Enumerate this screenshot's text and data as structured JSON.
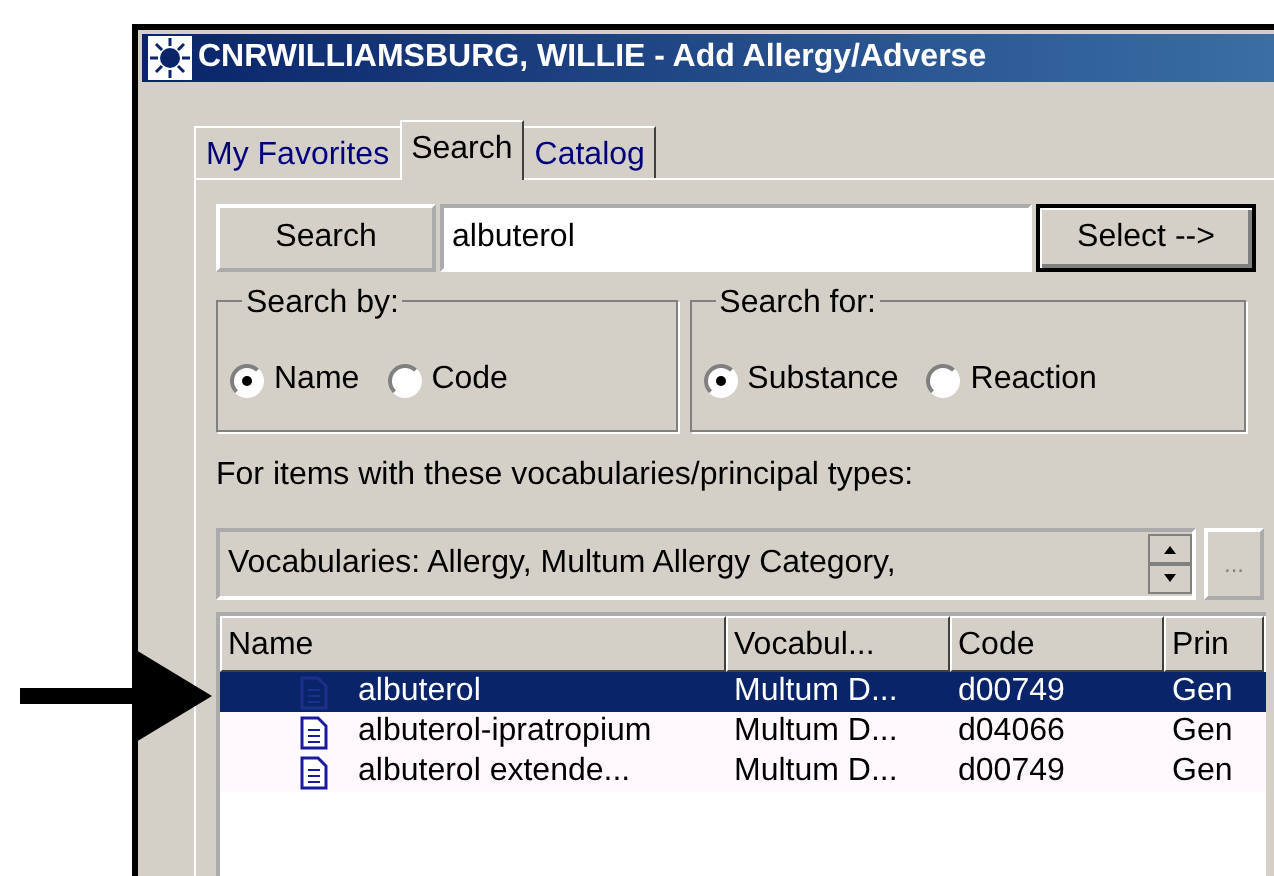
{
  "window": {
    "title": "CNRWILLIAMSBURG, WILLIE - Add Allergy/Adverse"
  },
  "tabs": [
    {
      "label": "My Favorites",
      "selected": false
    },
    {
      "label": "Search",
      "selected": true
    },
    {
      "label": "Catalog",
      "selected": false
    }
  ],
  "search": {
    "button": "Search",
    "value": "albuterol",
    "select_button": "Select -->"
  },
  "groups": [
    {
      "title": "Search by:",
      "options": [
        {
          "label": "Name",
          "checked": true
        },
        {
          "label": "Code",
          "checked": false
        }
      ]
    },
    {
      "title": "Search for:",
      "options": [
        {
          "label": "Substance",
          "checked": true
        },
        {
          "label": "Reaction",
          "checked": false
        }
      ]
    }
  ],
  "vocab_label": "For items with these vocabularies/principal types:",
  "vocab_field": {
    "value": "Vocabularies: Allergy, Multum Allergy Category,",
    "browse_button": "..."
  },
  "table": {
    "columns": [
      "Name",
      "Vocabul...",
      "Code",
      "Prin"
    ],
    "rows": [
      {
        "cells": [
          "albuterol",
          "Multum D...",
          "d00749",
          "Gen"
        ],
        "selected": true
      },
      {
        "cells": [
          "albuterol-ipratropium",
          "Multum D...",
          "d04066",
          "Gen"
        ],
        "selected": false
      },
      {
        "cells": [
          "albuterol extende...",
          "Multum D...",
          "d00749",
          "Gen"
        ],
        "selected": false
      }
    ]
  }
}
